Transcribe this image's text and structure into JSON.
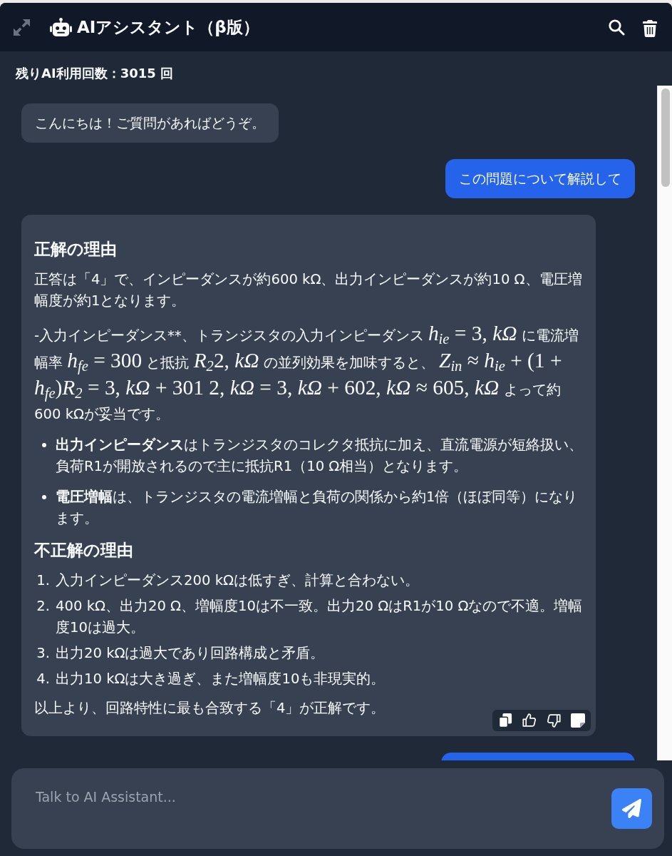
{
  "window": {
    "title": "AIアシスタント（β版）"
  },
  "usage_counter": "残りAI利用回数：3015 回",
  "messages": [
    {
      "kind": "assistant",
      "text": "こんにちは！ご質問があればどうぞ。",
      "toolbar": false
    },
    {
      "kind": "user",
      "text": "この問題について解説して"
    },
    {
      "kind": "assistant",
      "toolbar": true,
      "blocks": [
        {
          "kind": "heading",
          "text": "正解の理由"
        },
        {
          "kind": "paragraph",
          "text": "正答は「4」で、インピーダンスが約600 kΩ、出力インピーダンスが約10 Ω、電圧増幅度が約1となります。"
        },
        {
          "kind": "math_paragraph",
          "segments": [
            {
              "kind": "text",
              "text": "-入力インピーダンス**、トランジスタの入力インピーダンス "
            },
            {
              "kind": "math",
              "text": "*h*$_{ie}$ = 3, *kΩ*"
            },
            {
              "kind": "text",
              "text": " に電流増幅率 "
            },
            {
              "kind": "math",
              "text": "*h*$_{fe}$ = 300"
            },
            {
              "kind": "text",
              "text": " と抵抗 "
            },
            {
              "kind": "math",
              "text": "*R*$_{2}$2, *kΩ*"
            },
            {
              "kind": "text",
              "text": " の並列効果を加味すると、 "
            },
            {
              "kind": "math",
              "text": "*Z*$_{in}$ ≈ *h*$_{ie}$ + (1 + *h*$_{fe}$)*R*$_{2}$ = 3, *kΩ* + 301 2, *kΩ* = 3, *kΩ* + 602, *kΩ* ≈ 605, *kΩ*"
            },
            {
              "kind": "text",
              "text": " よって約600 kΩが妥当です。"
            }
          ]
        },
        {
          "kind": "bullets",
          "items": [
            "**出力インピーダンス**はトランジスタのコレクタ抵抗に加え、直流電源が短絡扱い、負荷R1が開放されるので主に抵抗R1（10 Ω相当）となります。",
            "**電圧増幅**は、トランジスタの電流増幅と負荷の関係から約1倍（ほぼ同等）になります。"
          ]
        },
        {
          "kind": "heading",
          "text": "不正解の理由"
        },
        {
          "kind": "numbered",
          "items": [
            {
              "number": "1.",
              "text": "入力インピーダンス200 kΩは低すぎ、計算と合わない。"
            },
            {
              "number": "2.",
              "text": "400 kΩ、出力20 Ω、増幅度10は不一致。出力20 ΩはR1が10 Ωなので不適。増幅度10は過大。"
            },
            {
              "number": "3.",
              "text": "出力20 kΩは過大であり回路構成と矛盾。"
            },
            {
              "number": "4.",
              "text": "出力10 kΩは大き過ぎ、また増幅度10も非現実的。"
            }
          ]
        },
        {
          "kind": "paragraph",
          "text": "以上より、回路特性に最も合致する「4」が正解です。"
        }
      ]
    },
    {
      "kind": "user"
    }
  ],
  "composer": {
    "placeholder": "Talk to AI Assistant..."
  }
}
